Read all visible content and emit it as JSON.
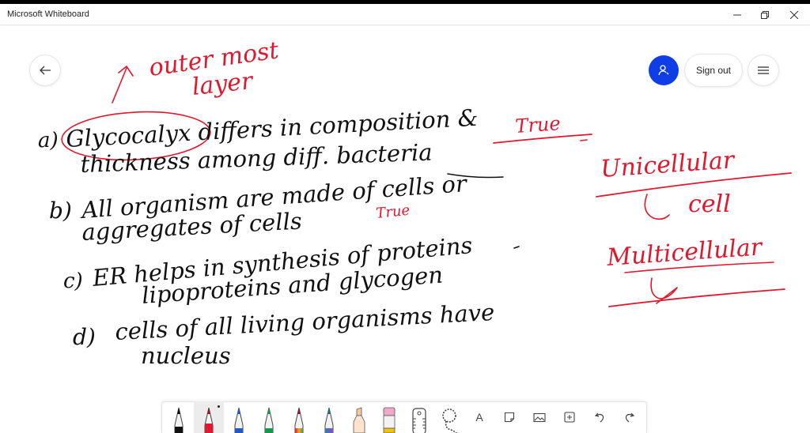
{
  "window": {
    "title": "Microsoft Whiteboard",
    "controls": [
      "minimize",
      "restore",
      "close"
    ]
  },
  "header": {
    "back_icon": "arrow-left-icon",
    "avatar_icon": "person-add-icon",
    "accent_color": "#0f3ee6",
    "sign_out_label": "Sign out",
    "menu_icon": "hamburger-icon"
  },
  "board": {
    "ink_colors": {
      "black": "#111111",
      "red": "#e0182d"
    },
    "annotation_top": [
      "outer most",
      "layer"
    ],
    "questions": [
      {
        "label": "a)",
        "lines": [
          "Glycocalyx differs in composition &",
          "thickness among diff. bacteria"
        ],
        "answer": "True"
      },
      {
        "label": "b)",
        "lines": [
          "All organism are made of cells or",
          "aggregates of cells"
        ],
        "answer": "True"
      },
      {
        "label": "c)",
        "lines": [
          "ER helps in synthesis of proteins",
          "lipoproteins and glycogen"
        ],
        "answer": ""
      },
      {
        "label": "d)",
        "lines": [
          "cells of all living organisms have",
          "nucleus"
        ],
        "answer": ""
      }
    ],
    "side_notes": [
      "Unicellular",
      "cell",
      "Multicellular"
    ]
  },
  "toolbar": {
    "pens": [
      {
        "name": "black-pen",
        "color": "#111111",
        "selected": false
      },
      {
        "name": "red-pen",
        "color": "#e0182d",
        "selected": true
      },
      {
        "name": "blue-pen",
        "color": "#1e5bc6",
        "selected": false
      },
      {
        "name": "green-pen",
        "color": "#129a4a",
        "selected": false
      },
      {
        "name": "rainbow-pen",
        "color": "#e06a1e",
        "selected": false
      },
      {
        "name": "galaxy-pen",
        "color": "#6b5bd0",
        "selected": false
      },
      {
        "name": "highlighter",
        "color": "#f7c99a",
        "selected": false
      },
      {
        "name": "eraser",
        "color": "#f2a9c9",
        "selected": false
      }
    ],
    "tools": [
      {
        "name": "ruler",
        "glyph": ""
      },
      {
        "name": "lasso",
        "glyph": ""
      },
      {
        "name": "text",
        "glyph": "A"
      },
      {
        "name": "sticky-note",
        "glyph": ""
      },
      {
        "name": "image",
        "glyph": ""
      },
      {
        "name": "insert",
        "glyph": "+"
      },
      {
        "name": "undo",
        "glyph": "↶"
      },
      {
        "name": "redo",
        "glyph": "↷"
      }
    ]
  }
}
